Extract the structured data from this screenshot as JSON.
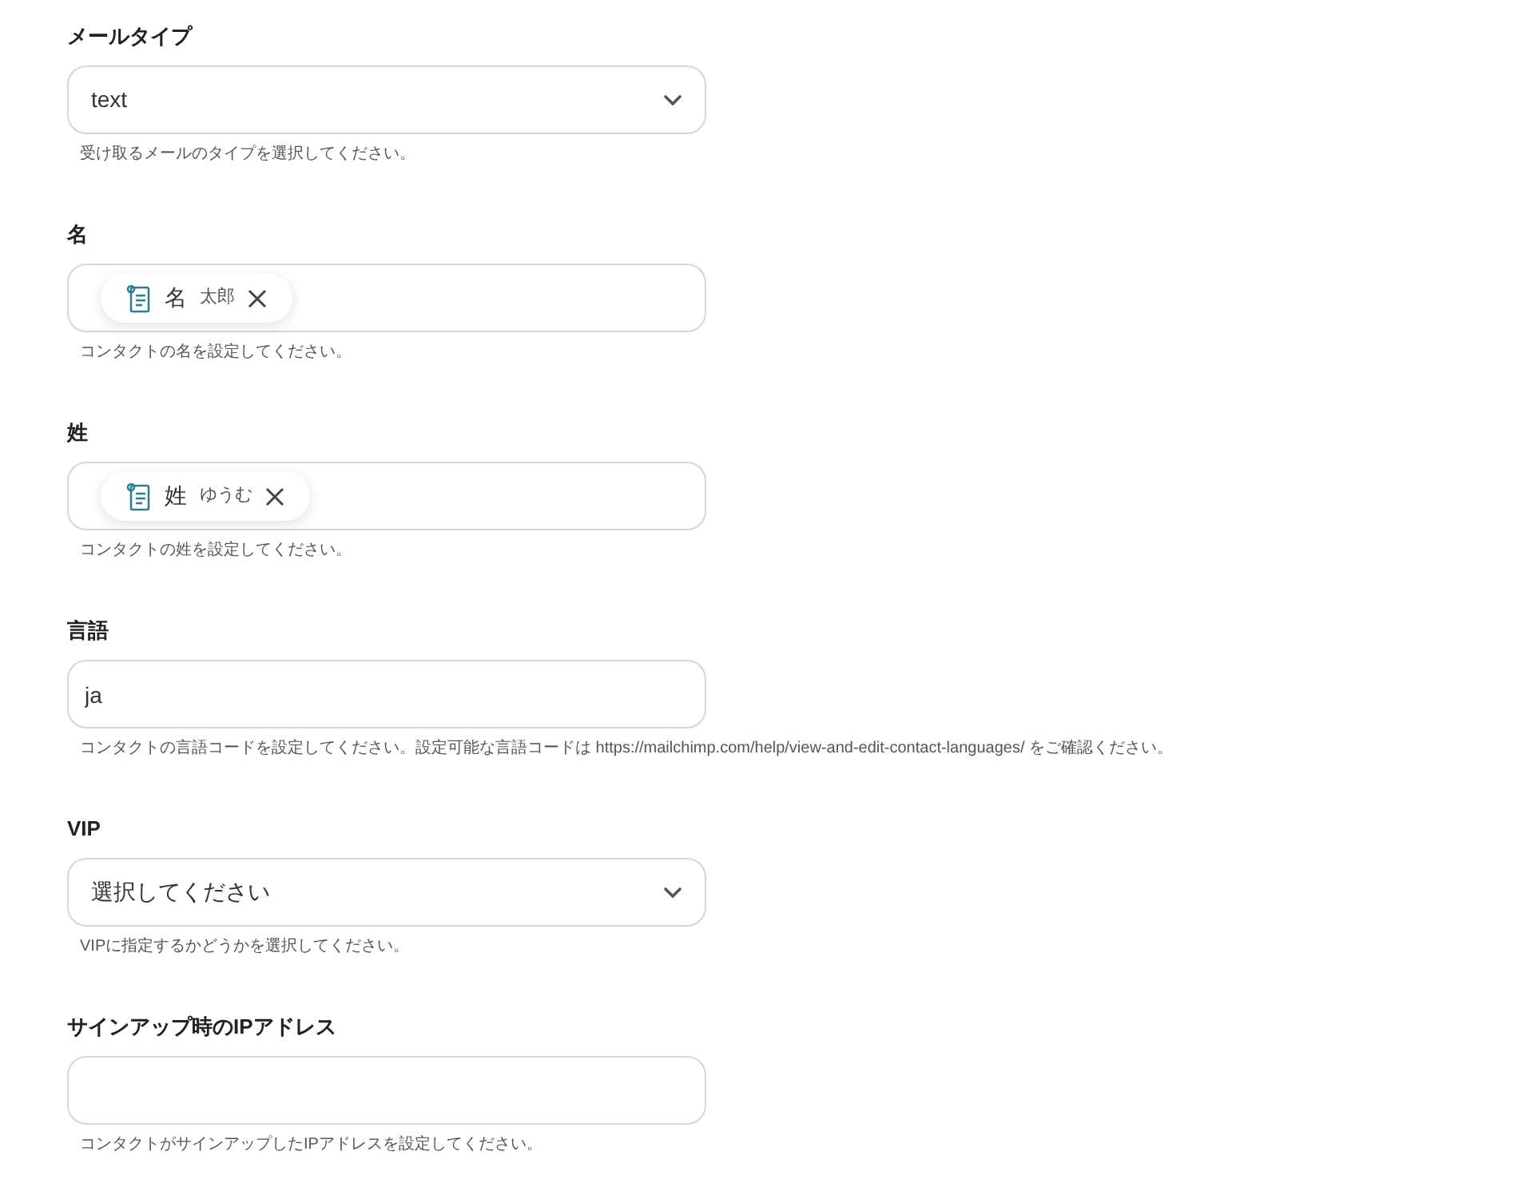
{
  "fields": [
    {
      "label": "メールタイプ",
      "kind": "select",
      "value": "text",
      "help": "受け取るメールのタイプを選択してください。"
    },
    {
      "label": "名",
      "kind": "tags",
      "tags": [
        {
          "name": "名",
          "value": "太郎"
        }
      ],
      "help": "コンタクトの名を設定してください。"
    },
    {
      "label": "姓",
      "kind": "tags",
      "tags": [
        {
          "name": "姓",
          "value": "ゆうむ"
        }
      ],
      "help": "コンタクトの姓を設定してください。"
    },
    {
      "label": "言語",
      "kind": "text",
      "value": "ja",
      "help": "コンタクトの言語コードを設定してください。設定可能な言語コードは https://mailchimp.com/help/view-and-edit-contact-languages/ をご確認ください。"
    },
    {
      "label": "VIP",
      "kind": "select",
      "value": "選択してください",
      "help": "VIPに指定するかどうかを選択してください。"
    },
    {
      "label": "サインアップ時のIPアドレス",
      "kind": "text",
      "help": "コンタクトがサインアップしたIPアドレスを設定してください。"
    }
  ]
}
